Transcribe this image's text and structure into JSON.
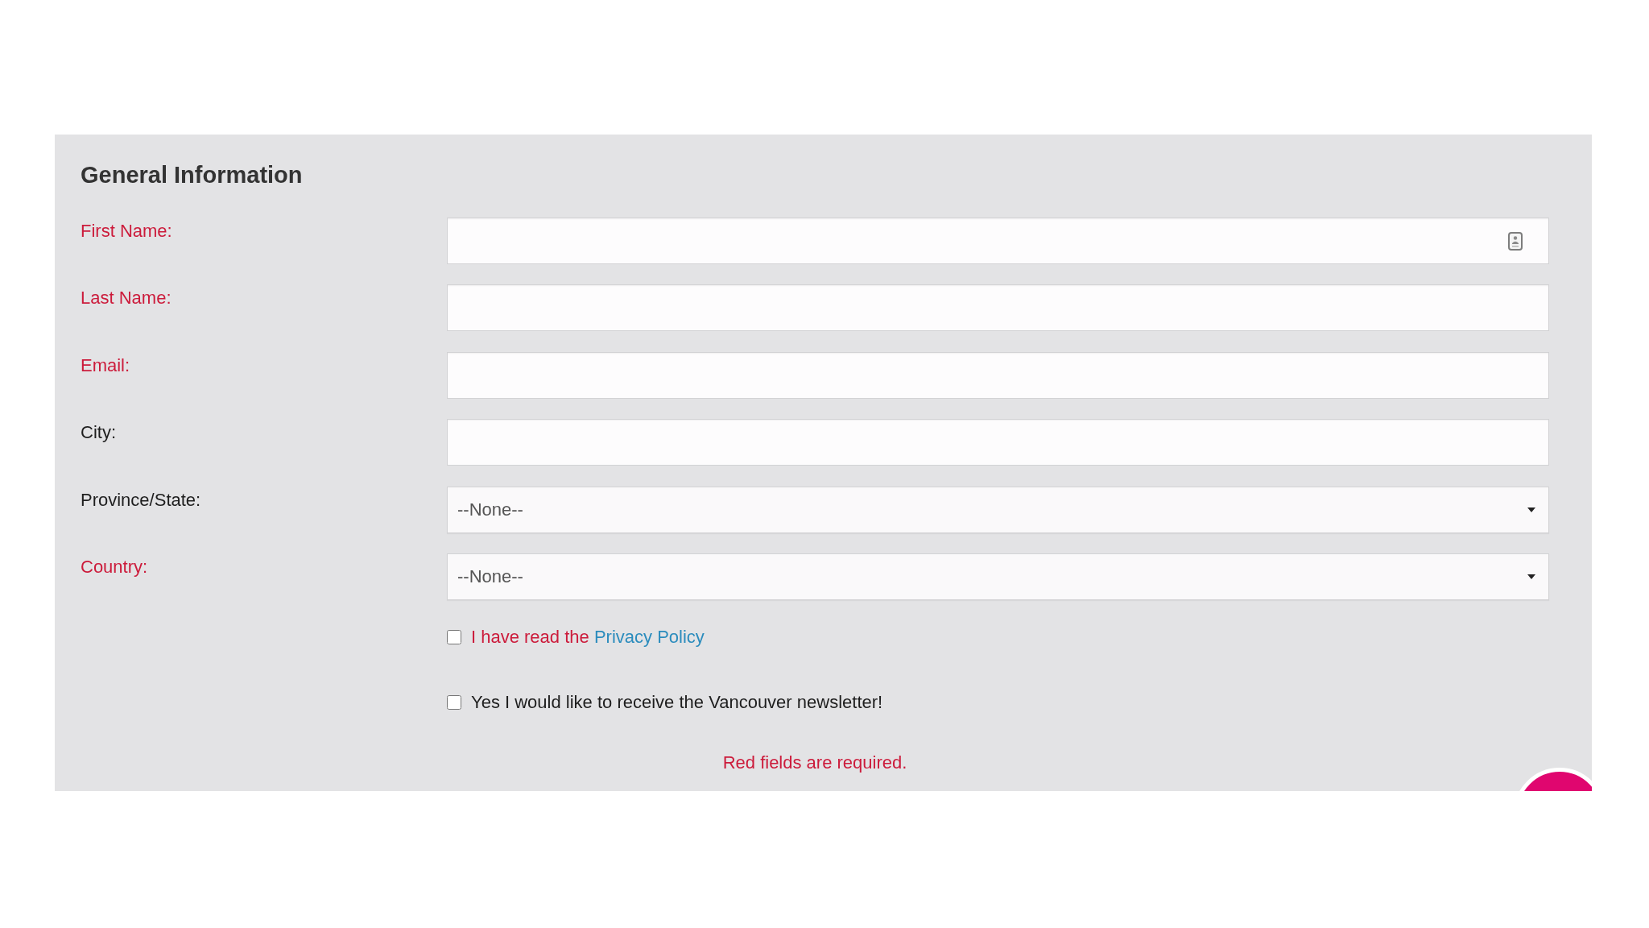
{
  "section": {
    "title": "General Information"
  },
  "fields": [
    {
      "label": "First Name:",
      "required": true,
      "kind": "text",
      "autofill_icon": true
    },
    {
      "label": "Last Name:",
      "required": true,
      "kind": "text",
      "autofill_icon": false
    },
    {
      "label": "Email:",
      "required": true,
      "kind": "text",
      "autofill_icon": false
    },
    {
      "label": "City:",
      "required": false,
      "kind": "text",
      "autofill_icon": false
    },
    {
      "label": "Province/State:",
      "required": false,
      "kind": "select",
      "value": "--None--"
    },
    {
      "label": "Country:",
      "required": true,
      "kind": "select",
      "value": "--None--"
    }
  ],
  "consents": [
    {
      "text": "I have read the",
      "link": "Privacy Policy",
      "required": true,
      "checked": false
    },
    {
      "text": "Yes I would like to receive the Vancouver newsletter!",
      "required": false,
      "checked": false
    }
  ],
  "note": "Red fields are required."
}
